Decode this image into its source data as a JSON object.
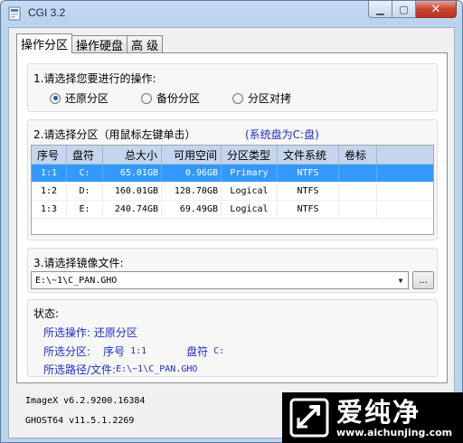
{
  "window": {
    "title": "CGI 3.2"
  },
  "tabs": [
    {
      "label": "操作分区",
      "active": true
    },
    {
      "label": "操作硬盘",
      "active": false
    },
    {
      "label": "高 级",
      "active": false
    }
  ],
  "operation": {
    "label": "1.请选择您要进行的操作:",
    "options": [
      "还原分区",
      "备份分区",
      "分区对拷"
    ],
    "selected": "还原分区"
  },
  "partition": {
    "label": "2.请选择分区（用鼠标左键单击）",
    "hint": "(系统盘为C:盘)",
    "columns": [
      "序号",
      "盘符",
      "总大小",
      "可用空间",
      "分区类型",
      "文件系统",
      "卷标"
    ],
    "rows": [
      [
        "1:1",
        "C:",
        "65.01GB",
        "0.96GB",
        "Primary",
        "NTFS",
        ""
      ],
      [
        "1:2",
        "D:",
        "160.01GB",
        "128.70GB",
        "Logical",
        "NTFS",
        ""
      ],
      [
        "1:3",
        "E:",
        "240.74GB",
        "69.49GB",
        "Logical",
        "NTFS",
        ""
      ]
    ],
    "selected_row": 0
  },
  "image": {
    "label": "3.请选择镜像文件:",
    "value": "E:\\~1\\C_PAN.GHO",
    "browse_label": "..."
  },
  "status": {
    "label": "状态:",
    "operation_label": "所选操作:",
    "operation_value": "还原分区",
    "partition_label": "所选分区:",
    "seq_label": "序号",
    "seq_value": "1:1",
    "drive_label": "盘符",
    "drive_value": "C:",
    "path_label": "所选路径/文件:",
    "path_value": "E:\\~1\\C_PAN.GHO"
  },
  "versions": {
    "imagex": "ImageX v6.2.9200.16384",
    "ghost": "GHOST64 v11.5.1.2269"
  },
  "watermark": {
    "text": "爱纯净",
    "url": "www.aichunjing.com"
  },
  "colors": {
    "selection": "#3399ff",
    "accent_text": "#1d2fc8",
    "header_bg": "#c4d6ee"
  }
}
